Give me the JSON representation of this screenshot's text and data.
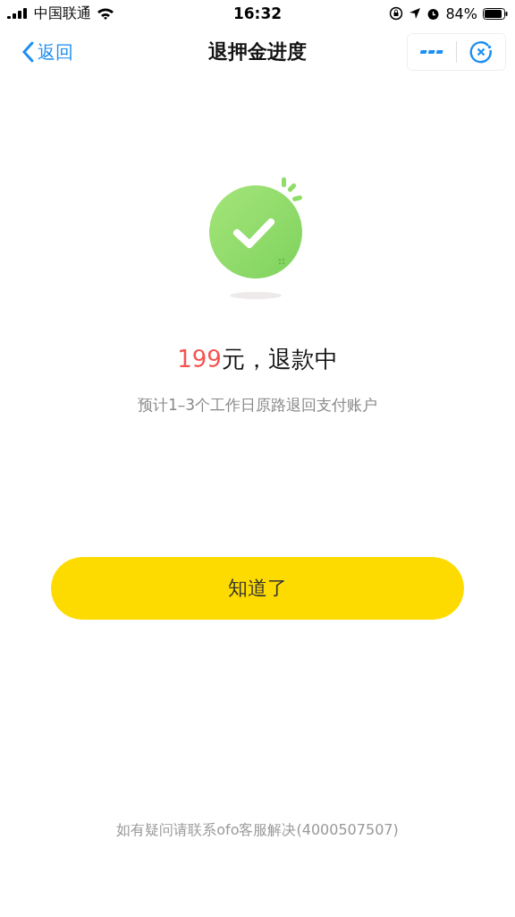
{
  "status_bar": {
    "carrier": "中国联通",
    "time": "16:32",
    "battery": "84%"
  },
  "nav": {
    "back": "返回",
    "title": "退押金进度"
  },
  "result": {
    "amount": "199",
    "status": "元，退款中",
    "note": "预计1–3个工作日原路退回支付账户"
  },
  "button": "知道了",
  "footer": "如有疑问请联系ofo客服解决(4000507507)"
}
